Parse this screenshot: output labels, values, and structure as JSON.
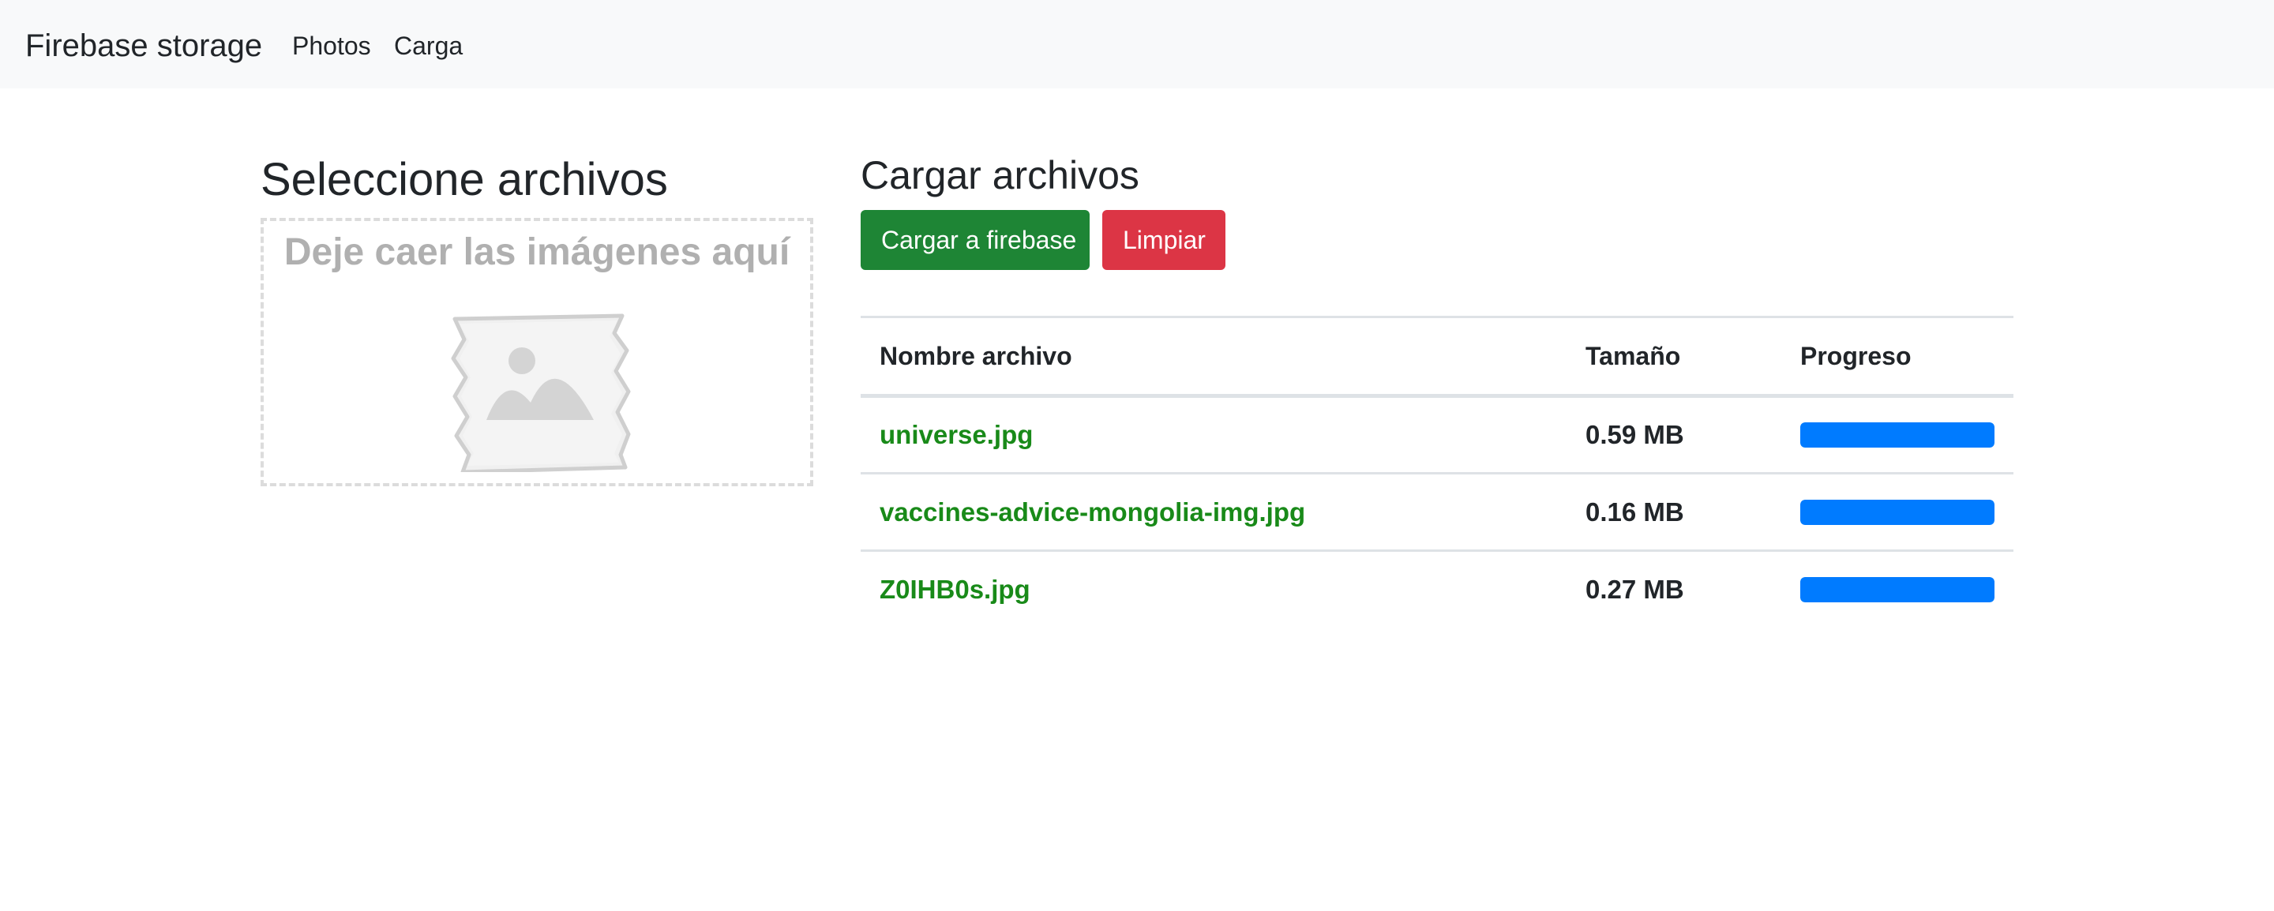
{
  "navbar": {
    "brand": "Firebase storage",
    "links": [
      "Photos",
      "Carga"
    ]
  },
  "left": {
    "title": "Seleccione archivos",
    "dropzone_text": "Deje caer las imágenes aquí",
    "dropzone_icon": "image-placeholder-icon"
  },
  "right": {
    "title": "Cargar archivos",
    "upload_button": "Cargar a firebase",
    "clear_button": "Limpiar"
  },
  "table": {
    "headers": [
      "Nombre archivo",
      "Tamaño",
      "Progreso"
    ],
    "rows": [
      {
        "name": "universe.jpg",
        "size": "0.59 MB",
        "progress": 1.0
      },
      {
        "name": "vaccines-advice-mongolia-img.jpg",
        "size": "0.16 MB",
        "progress": 1.0
      },
      {
        "name": "Z0IHB0s.jpg",
        "size": "0.27 MB",
        "progress": 1.0
      }
    ]
  },
  "colors": {
    "navbar_bg": "#f8f9fa",
    "success": "#1e8535",
    "danger": "#dc3545",
    "file_name": "#198a19",
    "progress": "#007bff"
  }
}
